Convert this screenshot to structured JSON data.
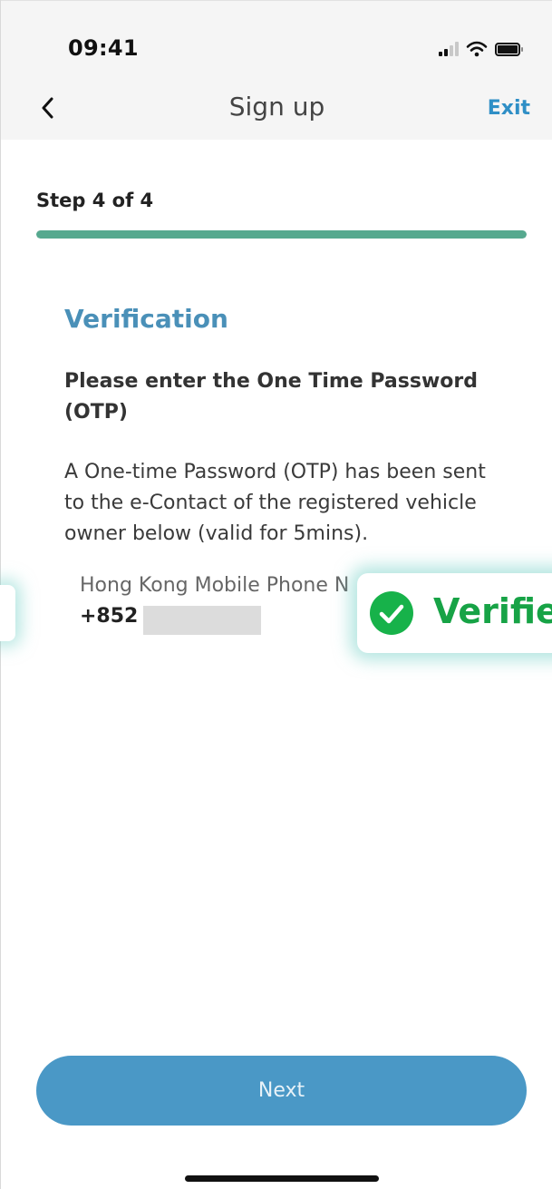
{
  "status_bar": {
    "time": "09:41",
    "icons": [
      "cellular-signal-icon",
      "wifi-icon",
      "battery-icon"
    ]
  },
  "nav": {
    "back_icon": "chevron-left-icon",
    "title": "Sign up",
    "exit_label": "Exit"
  },
  "progress": {
    "step_label": "Step 4 of 4",
    "fraction": 1.0
  },
  "content": {
    "section_title": "Verification",
    "instruction": "Please enter the One Time Password (OTP)",
    "description": "A One-time Password (OTP) has been sent to the e-Contact of the registered vehicle owner below (valid for 5mins).",
    "contact_label": "Hong Kong Mobile Phone N",
    "contact_prefix": "+852"
  },
  "overlay": {
    "verified_label": "Verifie",
    "icon": "check-circle-icon"
  },
  "footer": {
    "next_label": "Next"
  },
  "colors": {
    "accent_blue": "#4a98c6",
    "title_blue": "#4a90b8",
    "progress_green": "#56a98f",
    "verified_green": "#17b24a"
  }
}
